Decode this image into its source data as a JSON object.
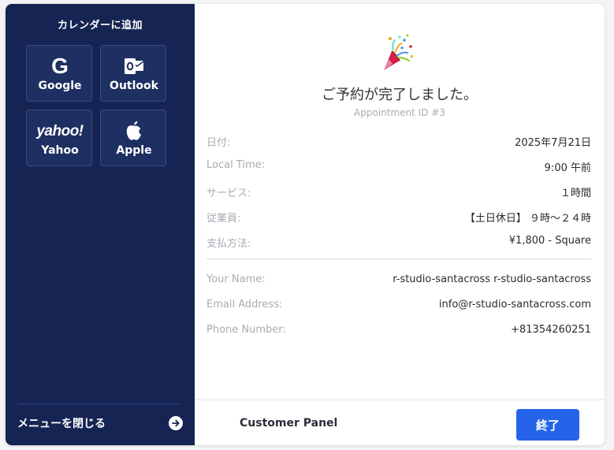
{
  "sidebar": {
    "title": "カレンダーに追加",
    "calendars": [
      {
        "label": "Google",
        "icon": "google-g-icon"
      },
      {
        "label": "Outlook",
        "icon": "outlook-icon"
      },
      {
        "label": "Yahoo",
        "icon": "yahoo-logo-icon",
        "logo_text": "yahoo!"
      },
      {
        "label": "Apple",
        "icon": "apple-icon"
      }
    ],
    "close_menu_label": "メニューを閉じる",
    "close_menu_icon": "arrow-right-circle-icon",
    "background_color": "#152452"
  },
  "main": {
    "icon": "party-popper-icon",
    "title": "ご予約が完了しました。",
    "appointment_id": "Appointment ID #3",
    "details": [
      {
        "label": "日付:",
        "value": "2025年7月21日"
      },
      {
        "label": "Local Time:",
        "value": "9:00 午前"
      },
      {
        "label": "サービス:",
        "value": "１時間"
      },
      {
        "label": "従業員:",
        "value": "【土日休日】 ９時〜２４時"
      },
      {
        "label": "支払方法:",
        "value": "¥1,800 - Square"
      }
    ],
    "customer": [
      {
        "label": "Your Name:",
        "value": "r-studio-santacross r-studio-santacross"
      },
      {
        "label": "Email Address:",
        "value": "info@r-studio-santacross.com"
      },
      {
        "label": "Phone Number:",
        "value": "+81354260251"
      }
    ]
  },
  "footer": {
    "customer_panel_label": "Customer Panel",
    "finish_label": "終了",
    "finish_color": "#2563eb"
  }
}
